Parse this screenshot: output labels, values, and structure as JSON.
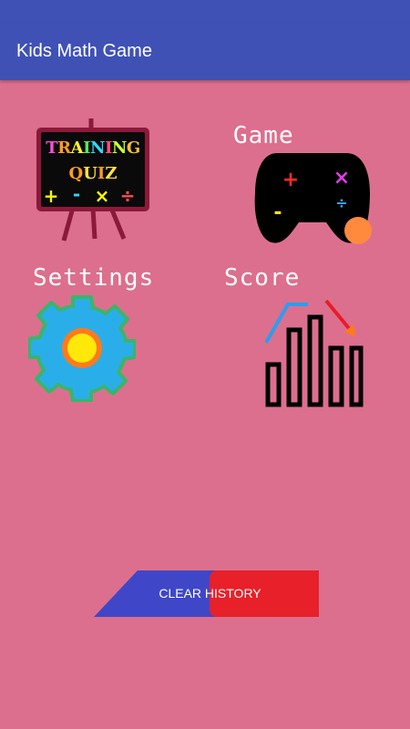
{
  "app": {
    "title": "Kids Math Game"
  },
  "tiles": {
    "training": {
      "board_line1": "TRAINING",
      "board_line2": "QUIZ",
      "board_ops": [
        "+",
        "-",
        "×",
        "÷"
      ]
    },
    "game": {
      "label": "Game",
      "pad_ops": [
        "+",
        "×",
        "-",
        "÷"
      ]
    },
    "settings": {
      "label": "Settings"
    },
    "score": {
      "label": "Score"
    }
  },
  "actions": {
    "clear_history": "CLEAR HISTORY"
  },
  "colors": {
    "appbar": "#3f51b5",
    "background": "#dc6f8e",
    "button_blue": "#3f47c8",
    "button_red": "#e8202a"
  }
}
